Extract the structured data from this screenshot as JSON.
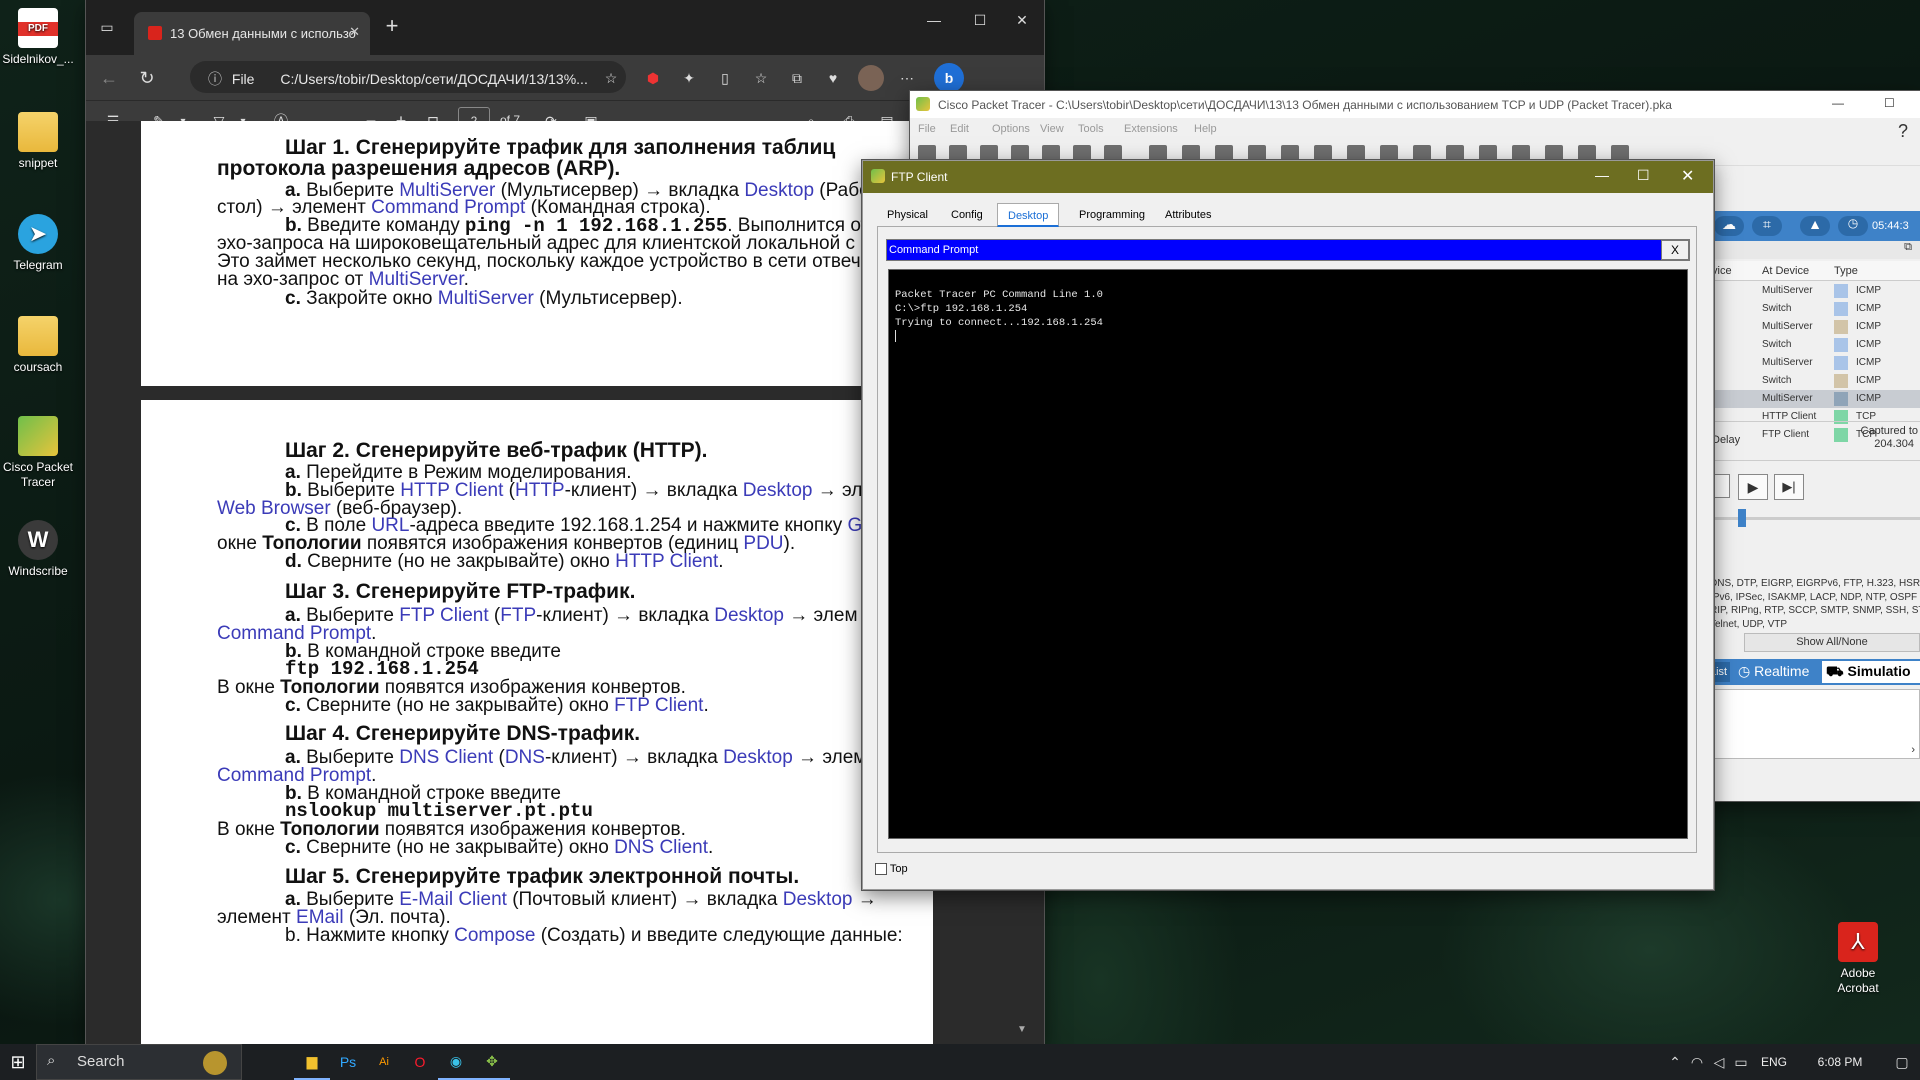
{
  "desktop_icons": [
    {
      "label": "Sidelnikov_...",
      "icon": "pdf-file-icon",
      "badge": "PDF"
    },
    {
      "label": "snippet",
      "icon": "folder-zip-icon"
    },
    {
      "label": "Telegram",
      "icon": "telegram-icon"
    },
    {
      "label": "coursach",
      "icon": "folder-zip-icon"
    },
    {
      "label": "Cisco Packet Tracer",
      "icon": "packet-tracer-icon"
    },
    {
      "label": "Windscribe",
      "icon": "windscribe-icon"
    },
    {
      "label": "Adobe Acrobat",
      "icon": "acrobat-icon"
    }
  ],
  "edge": {
    "tab_title": "13 Обмен данными с использо",
    "file_label": "File",
    "url": "C:/Users/tobir/Desktop/сети/ДОСДАЧИ/13/13%...",
    "page_current": "2",
    "page_total": "of 7"
  },
  "pdf": {
    "page1": [
      {
        "segs": [
          [
            "Шаг 1. Сгенерируйте трафик для заполнения таблиц",
            "h"
          ]
        ]
      },
      {
        "segs": [
          [
            "протокола разрешения адресов (ARP).",
            "h"
          ]
        ]
      },
      {
        "segs": [
          [
            "a. ",
            "b"
          ],
          [
            "Выберите ",
            ""
          ],
          [
            "MultiServer",
            "l"
          ],
          [
            " (Мультисервер) → вкладка ",
            ""
          ],
          [
            "Desktop",
            "l"
          ],
          [
            " (Рабо",
            ""
          ]
        ]
      },
      {
        "segs": [
          [
            "стол) → элемент ",
            ""
          ],
          [
            "Command Prompt",
            "l"
          ],
          [
            " (Командная строка).",
            ""
          ]
        ]
      },
      {
        "segs": [
          [
            "b. ",
            "b"
          ],
          [
            "Введите команду ",
            ""
          ],
          [
            "ping -n 1 192.168.1.255",
            "m"
          ],
          [
            ". Выполнится отпра",
            ""
          ]
        ]
      },
      {
        "segs": [
          [
            "эхо-запроса на широковещательный адрес для клиентской локальной с",
            ""
          ]
        ]
      },
      {
        "segs": [
          [
            "Это займет несколько секунд, поскольку каждое устройство в сети отвеч",
            ""
          ]
        ]
      },
      {
        "segs": [
          [
            "на эхо-запрос от ",
            ""
          ],
          [
            "MultiServer",
            "l"
          ],
          [
            ".",
            ""
          ]
        ]
      },
      {
        "segs": [
          [
            "c. ",
            "b"
          ],
          [
            "Закройте окно ",
            ""
          ],
          [
            "MultiServer",
            "l"
          ],
          [
            " (Мультисервер).",
            ""
          ]
        ]
      }
    ],
    "page2": [
      {
        "segs": [
          [
            "Шаг 2. Сгенерируйте веб-трафик (HTTP).",
            "h"
          ]
        ]
      },
      {
        "segs": [
          [
            "a. ",
            "b"
          ],
          [
            "Перейдите в Режим моделирования.",
            ""
          ]
        ]
      },
      {
        "segs": [
          [
            "b. ",
            "b"
          ],
          [
            "Выберите ",
            ""
          ],
          [
            "HTTP Client",
            "l"
          ],
          [
            " (",
            ""
          ],
          [
            "HTTP",
            "l"
          ],
          [
            "-клиент) → вкладка ",
            ""
          ],
          [
            "Desktop",
            "l"
          ],
          [
            " → элем",
            ""
          ]
        ]
      },
      {
        "segs": [
          [
            "Web Browser",
            "l"
          ],
          [
            " (веб-браузер).",
            ""
          ]
        ]
      },
      {
        "segs": [
          [
            "c. ",
            "b"
          ],
          [
            "В поле ",
            ""
          ],
          [
            "URL",
            "l"
          ],
          [
            "-адреса введите 192.168.1.254 и нажмите кнопку ",
            ""
          ],
          [
            "G",
            "l"
          ]
        ]
      },
      {
        "segs": [
          [
            "окне ",
            ""
          ],
          [
            "Топологии",
            "b"
          ],
          [
            " появятся изображения конвертов (единиц ",
            ""
          ],
          [
            "PDU",
            "l"
          ],
          [
            ").",
            ""
          ]
        ]
      },
      {
        "segs": [
          [
            "d. ",
            "b"
          ],
          [
            "Сверните (но не закрывайте) окно ",
            ""
          ],
          [
            "HTTP Client",
            "l"
          ],
          [
            ".",
            ""
          ]
        ]
      },
      {
        "segs": [
          [
            "Шаг 3. Сгенерируйте FTP-трафик.",
            "h"
          ]
        ]
      },
      {
        "segs": [
          [
            "a. ",
            "b"
          ],
          [
            "Выберите ",
            ""
          ],
          [
            "FTP Client",
            "l"
          ],
          [
            " (",
            ""
          ],
          [
            "FTP",
            "l"
          ],
          [
            "-клиент) → вкладка ",
            ""
          ],
          [
            "Desktop",
            "l"
          ],
          [
            " → элем",
            ""
          ]
        ]
      },
      {
        "segs": [
          [
            "Command Prompt",
            "l"
          ],
          [
            ".",
            ""
          ]
        ]
      },
      {
        "segs": [
          [
            "b. ",
            "b"
          ],
          [
            "В командной строке введите",
            ""
          ]
        ]
      },
      {
        "segs": [
          [
            "ftp 192.168.1.254",
            "m"
          ]
        ]
      },
      {
        "segs": [
          [
            "В окне ",
            ""
          ],
          [
            "Топологии",
            "b"
          ],
          [
            " появятся изображения конвертов.",
            ""
          ]
        ]
      },
      {
        "segs": [
          [
            "c. ",
            "b"
          ],
          [
            "Сверните (но не закрывайте) окно ",
            ""
          ],
          [
            "FTP Client",
            "l"
          ],
          [
            ".",
            ""
          ]
        ]
      },
      {
        "segs": [
          [
            "Шаг 4. Сгенерируйте DNS-трафик.",
            "h"
          ]
        ]
      },
      {
        "segs": [
          [
            "a. ",
            "b"
          ],
          [
            "Выберите ",
            ""
          ],
          [
            "DNS Client",
            "l"
          ],
          [
            " (",
            ""
          ],
          [
            "DNS",
            "l"
          ],
          [
            "-клиент) → вкладка ",
            ""
          ],
          [
            "Desktop",
            "l"
          ],
          [
            " → элем",
            ""
          ]
        ]
      },
      {
        "segs": [
          [
            "Command Prompt",
            "l"
          ],
          [
            ".",
            ""
          ]
        ]
      },
      {
        "segs": [
          [
            "b. ",
            "b"
          ],
          [
            "В командной строке введите",
            ""
          ]
        ]
      },
      {
        "segs": [
          [
            "nslookup multiserver.pt.ptu",
            "m"
          ]
        ]
      },
      {
        "segs": [
          [
            "В окне ",
            ""
          ],
          [
            "Топологии",
            "b"
          ],
          [
            " появятся изображения конвертов.",
            ""
          ]
        ]
      },
      {
        "segs": [
          [
            "c. ",
            "b"
          ],
          [
            "Сверните (но не закрывайте) окно ",
            ""
          ],
          [
            "DNS Client",
            "l"
          ],
          [
            ".",
            ""
          ]
        ]
      },
      {
        "segs": [
          [
            "Шаг 5. Сгенерируйте трафик электронной почты.",
            "h"
          ]
        ]
      },
      {
        "segs": [
          [
            "a. ",
            "b"
          ],
          [
            "Выберите ",
            ""
          ],
          [
            "E-Mail Client",
            "l"
          ],
          [
            " (Почтовый клиент) → вкладка ",
            ""
          ],
          [
            "Desktop",
            "l"
          ],
          [
            " →",
            ""
          ]
        ]
      },
      {
        "segs": [
          [
            "элемент ",
            ""
          ],
          [
            "EMail",
            "l"
          ],
          [
            " (Эл. почта).",
            ""
          ]
        ]
      },
      {
        "segs": [
          [
            "b. Нажмите кнопку ",
            ""
          ],
          [
            "Compose",
            "l"
          ],
          [
            " (Создать) и введите следующие данные:",
            ""
          ]
        ]
      }
    ]
  },
  "pt": {
    "title": "Cisco Packet Tracer - C:\\Users\\tobir\\Desktop\\сети\\ДОСДАЧИ\\13\\13 Обмен данными с использованием TCP и UDP (Packet Tracer).pka",
    "menu": [
      "File",
      "Edit",
      "Options",
      "View",
      "Tools",
      "Extensions",
      "Help"
    ],
    "clock": "05:44:3",
    "table_headers": [
      "vice",
      "At Device",
      "Type"
    ],
    "events": [
      {
        "device": "MultiServer",
        "type": "ICMP",
        "color": "#a9c4e8"
      },
      {
        "device": "Switch",
        "type": "ICMP",
        "color": "#a9c4e8"
      },
      {
        "device": "MultiServer",
        "type": "ICMP",
        "color": "#d2c4a8"
      },
      {
        "device": "Switch",
        "type": "ICMP",
        "color": "#a9c4e8"
      },
      {
        "device": "MultiServer",
        "type": "ICMP",
        "color": "#a9c4e8"
      },
      {
        "device": "Switch",
        "type": "ICMP",
        "color": "#d2c4a8"
      },
      {
        "device": "MultiServer",
        "type": "ICMP",
        "color": "#8fa4b8",
        "selected": true
      },
      {
        "device": "HTTP Client",
        "type": "TCP",
        "color": "#7ed6a6"
      },
      {
        "device": "FTP Client",
        "type": "TCP",
        "color": "#7ed6a6"
      }
    ],
    "delay_label": "Delay",
    "captured_label": "Captured to",
    "captured_value": "204.304",
    "protocols": [
      "DNS, DTP, EIGRP, EIGRPv6, FTP, H.323, HSR",
      "IPv6, IPSec, ISAKMP, LACP, NDP, NTP, OSPF",
      "RIP, RIPng, RTP, SCCP, SMTP, SNMP, SSH, ST",
      "Telnet, UDP, VTP"
    ],
    "show_all": "Show All/None",
    "list_tab": "List",
    "realtime": "Realtime",
    "simulation": "Simulatio"
  },
  "ftp": {
    "title": "FTP Client",
    "tabs": [
      "Physical",
      "Config",
      "Desktop",
      "Programming",
      "Attributes"
    ],
    "active_tab": "Desktop",
    "panel_title": "Command Prompt",
    "panel_close": "X",
    "console": [
      "Packet Tracer PC Command Line 1.0",
      "C:\\>ftp 192.168.1.254",
      "Trying to connect...192.168.1.254"
    ],
    "top_label": "Top"
  },
  "taskbar": {
    "search": "Search",
    "lang": "ENG",
    "time": "6:08 PM"
  }
}
